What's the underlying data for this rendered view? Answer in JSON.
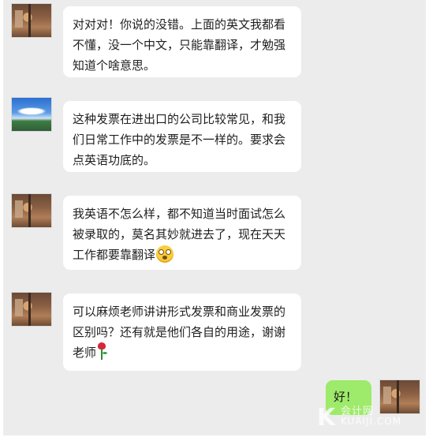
{
  "messages": [
    {
      "sender": "other",
      "avatar": "room-photo-avatar",
      "lines": [
        "对对对！你说的没错。上面的英文我都看",
        "不懂，没一个中文，只能靠翻译，才勉强",
        "知道个啥意思。"
      ]
    },
    {
      "sender": "other",
      "avatar": "sky-photo-avatar",
      "lines": [
        "这种发票在进出口的公司比较常见，和我",
        "们日常工作中的发票是不一样的。要求会",
        "点英语功底的。"
      ]
    },
    {
      "sender": "other",
      "avatar": "room-photo-avatar",
      "lines": [
        "我英语不怎么样，都不知道当时面试怎么",
        "被录取的，莫名其妙就进去了，现在天天",
        "工作都要靠翻译"
      ],
      "trailing_emoji": "flushed-face-emoji"
    },
    {
      "sender": "other",
      "avatar": "room-photo-avatar",
      "lines": [
        "可以麻烦老师讲讲形式发票和商业发票的",
        "区别吗？还有就是他们各自的用途，谢谢",
        "老师"
      ],
      "trailing_emoji": "rose-emoji"
    },
    {
      "sender": "self",
      "avatar": "room-photo-avatar",
      "lines": [
        "好！"
      ]
    }
  ],
  "watermark": {
    "mark": "K",
    "cn": "会计网",
    "en": "KUAIJI.COM"
  }
}
